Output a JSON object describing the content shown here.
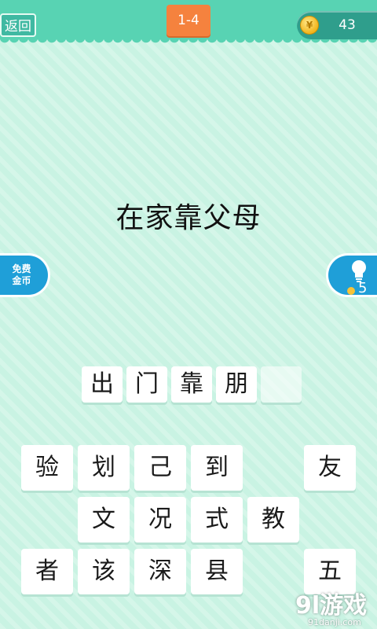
{
  "header": {
    "back_label": "返回",
    "level": "1-4",
    "coins": "43",
    "coin_symbol": "¥"
  },
  "puzzle": {
    "idiom": "在家靠父母"
  },
  "side": {
    "free_coins_line1": "免费",
    "free_coins_line2": "金币",
    "hint_count": "5"
  },
  "answer_slots": [
    "出",
    "门",
    "靠",
    "朋",
    ""
  ],
  "keyboard": {
    "row1": [
      "验",
      "划",
      "己",
      "到",
      "友"
    ],
    "row2": [
      "文",
      "况",
      "式",
      "教"
    ],
    "row3": [
      "者",
      "该",
      "深",
      "县",
      "五"
    ]
  },
  "watermark": {
    "logo": "9l游戏",
    "site": "91danji.com"
  },
  "colors": {
    "background": "#c9f3e3",
    "header": "#58d3b3",
    "level_badge": "#f5823e",
    "side_button": "#1f9fd8"
  }
}
